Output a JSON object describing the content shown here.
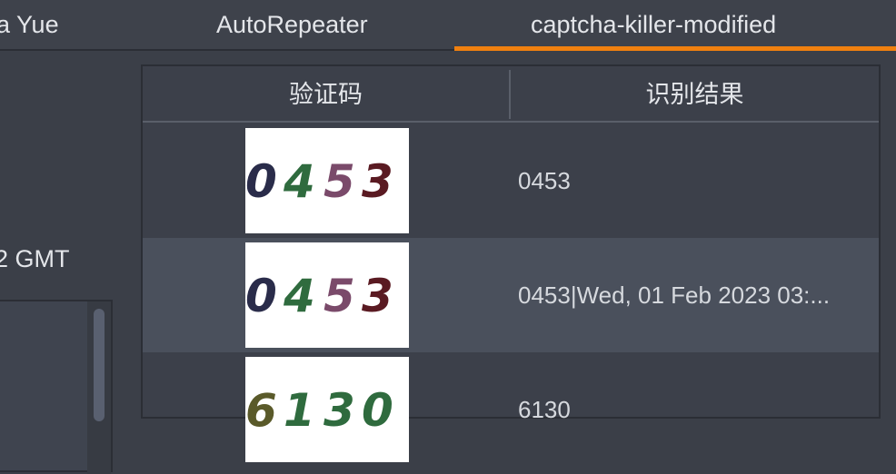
{
  "tabs": [
    {
      "label": "a Yue"
    },
    {
      "label": "AutoRepeater"
    },
    {
      "label": "captcha-killer-modified",
      "active": true
    }
  ],
  "accent_color": "#f0800f",
  "left_panel": {
    "text": "2 GMT"
  },
  "table": {
    "headers": [
      "验证码",
      "识别结果"
    ],
    "rows": [
      {
        "captcha_chars": [
          {
            "ch": "0",
            "color": "#2a2c4a"
          },
          {
            "ch": "4",
            "color": "#2f6b3e"
          },
          {
            "ch": "5",
            "color": "#7a4a6a"
          },
          {
            "ch": "3",
            "color": "#5a1a22"
          }
        ],
        "result": "0453"
      },
      {
        "captcha_chars": [
          {
            "ch": "0",
            "color": "#2a2c4a"
          },
          {
            "ch": "4",
            "color": "#2f6b3e"
          },
          {
            "ch": "5",
            "color": "#7a4a6a"
          },
          {
            "ch": "3",
            "color": "#5a1a22"
          }
        ],
        "result": "0453|Wed, 01 Feb 2023 03:..."
      },
      {
        "captcha_chars": [
          {
            "ch": "6",
            "color": "#5a5a2a"
          },
          {
            "ch": "1",
            "color": "#2f6b3e"
          },
          {
            "ch": "3",
            "color": "#2f6b3e"
          },
          {
            "ch": "0",
            "color": "#2f6b3e"
          }
        ],
        "result": "6130"
      }
    ]
  }
}
